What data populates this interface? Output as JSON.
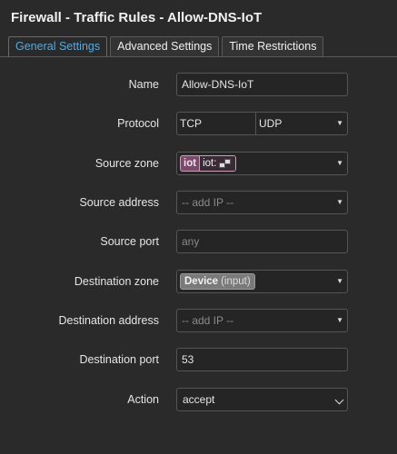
{
  "page": {
    "title": "Firewall - Traffic Rules - Allow-DNS-IoT"
  },
  "tabs": [
    {
      "label": "General Settings",
      "active": true
    },
    {
      "label": "Advanced Settings",
      "active": false
    },
    {
      "label": "Time Restrictions",
      "active": false
    }
  ],
  "form": {
    "name": {
      "label": "Name",
      "value": "Allow-DNS-IoT"
    },
    "protocol": {
      "label": "Protocol",
      "values": [
        "TCP",
        "UDP"
      ]
    },
    "source_zone": {
      "label": "Source zone",
      "zone": "iot",
      "inner": "iot:",
      "icon": "network-icon"
    },
    "source_address": {
      "label": "Source address",
      "placeholder": "-- add IP --"
    },
    "source_port": {
      "label": "Source port",
      "placeholder": "any"
    },
    "destination_zone": {
      "label": "Destination zone",
      "device": "Device",
      "sub": "(input)"
    },
    "destination_address": {
      "label": "Destination address",
      "placeholder": "-- add IP --"
    },
    "destination_port": {
      "label": "Destination port",
      "value": "53"
    },
    "action": {
      "label": "Action",
      "value": "accept"
    }
  },
  "colors": {
    "active_tab": "#5ba8d8",
    "zone_chip": "#7a4a6a",
    "device_chip": "#7a7a7a",
    "background": "#2a2a2a"
  }
}
